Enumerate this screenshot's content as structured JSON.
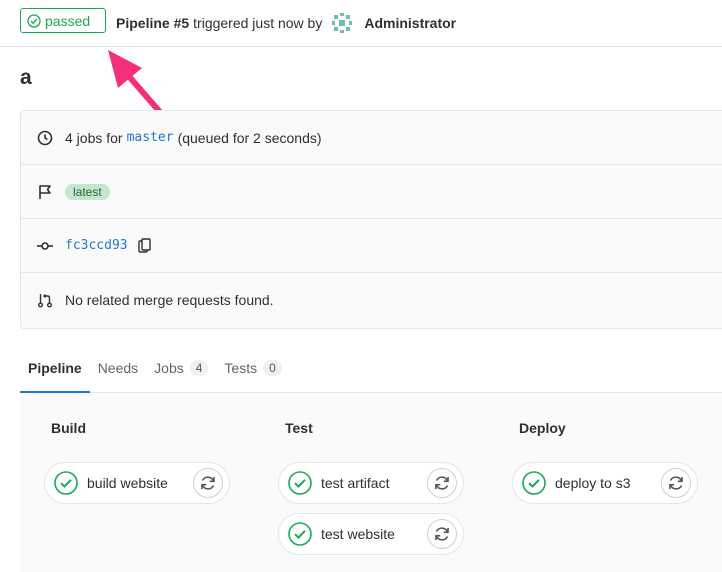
{
  "header": {
    "status": "passed",
    "pipeline": "Pipeline #5",
    "triggered": "triggered just now by",
    "author": "Administrator"
  },
  "title": "a",
  "info": {
    "jobs_prefix": "4 jobs for",
    "branch": "master",
    "queued": "(queued for 2 seconds)",
    "tag": "latest",
    "commit": "fc3ccd93",
    "merge_requests": "No related merge requests found."
  },
  "tabs": [
    {
      "label": "Pipeline",
      "count": null
    },
    {
      "label": "Needs",
      "count": null
    },
    {
      "label": "Jobs",
      "count": "4"
    },
    {
      "label": "Tests",
      "count": "0"
    }
  ],
  "stages": [
    {
      "name": "Build",
      "jobs": [
        "build website"
      ]
    },
    {
      "name": "Test",
      "jobs": [
        "test artifact",
        "test website"
      ]
    },
    {
      "name": "Deploy",
      "jobs": [
        "deploy to s3"
      ]
    }
  ],
  "colors": {
    "success": "#1aaa55",
    "link": "#1f78d1",
    "annotation": "#f5307a"
  }
}
